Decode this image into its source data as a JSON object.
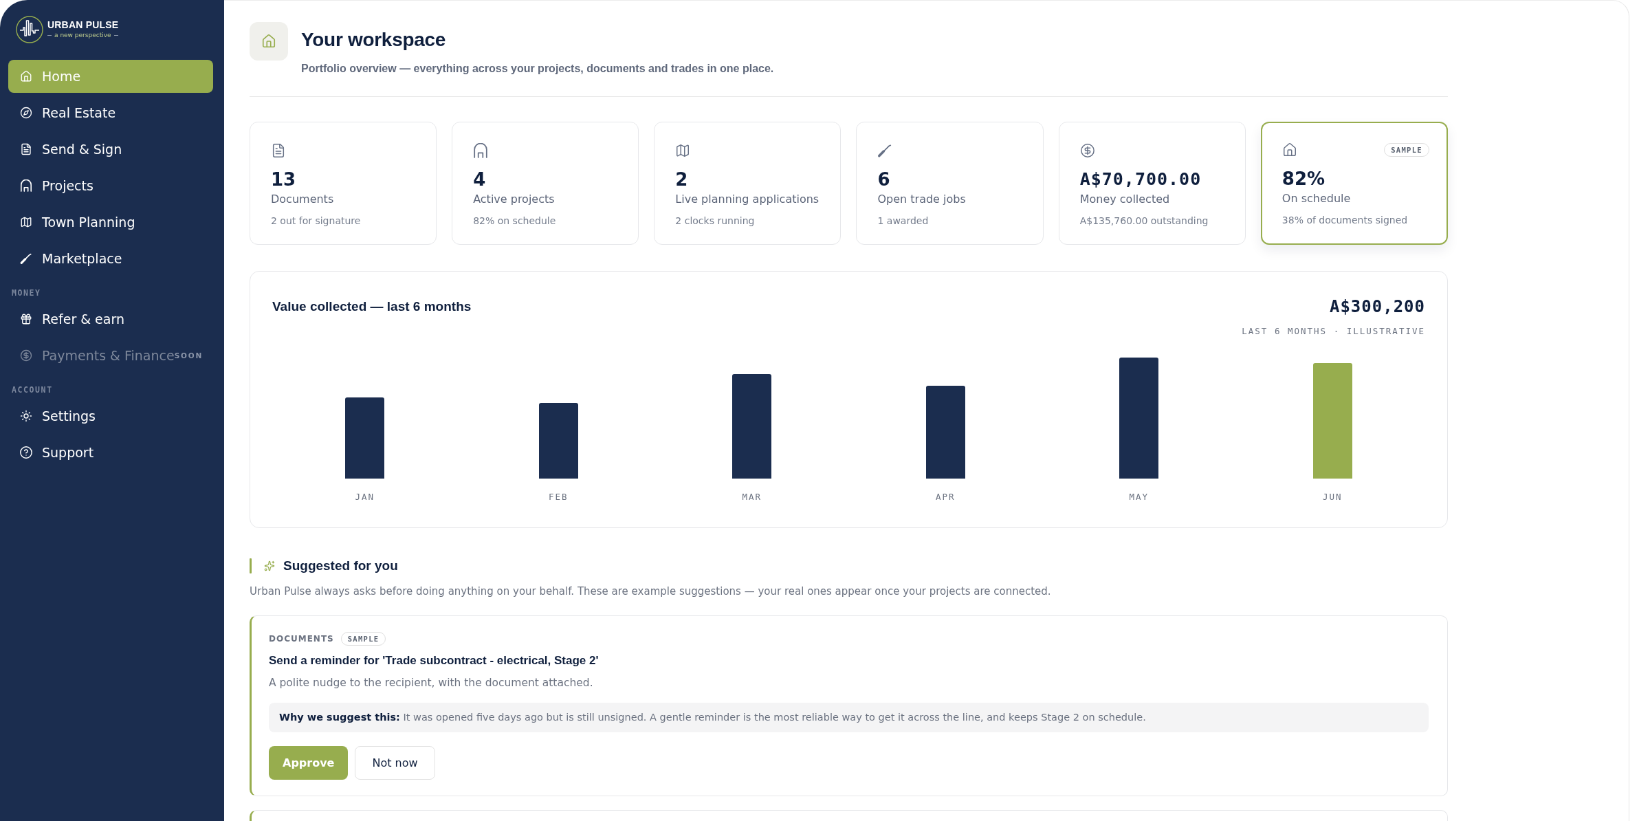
{
  "brand": {
    "name": "URBAN PULSE",
    "tagline": "a new perspective"
  },
  "sidebar": {
    "sections": [
      {
        "items": [
          {
            "label": "Home",
            "selected": true,
            "disabled": false
          },
          {
            "label": "Real Estate",
            "selected": false,
            "disabled": false
          },
          {
            "label": "Send & Sign",
            "selected": false,
            "disabled": false
          },
          {
            "label": "Projects",
            "selected": false,
            "disabled": false
          },
          {
            "label": "Town Planning",
            "selected": false,
            "disabled": false
          },
          {
            "label": "Marketplace",
            "selected": false,
            "disabled": false
          }
        ]
      },
      {
        "title": "MONEY",
        "items": [
          {
            "label": "Refer & earn",
            "selected": false,
            "disabled": false
          },
          {
            "label": "Payments & Finance",
            "selected": false,
            "disabled": true,
            "badge": "SOON"
          }
        ]
      },
      {
        "title": "ACCOUNT",
        "items": [
          {
            "label": "Settings",
            "selected": false,
            "disabled": false
          },
          {
            "label": "Support",
            "selected": false,
            "disabled": false
          }
        ]
      }
    ]
  },
  "header": {
    "title": "Your workspace",
    "subtitle": "Portfolio overview — everything across your projects, documents and trades in one place."
  },
  "stats": [
    {
      "kind": "count",
      "value": "13",
      "label": "Documents",
      "note": "2 out for signature",
      "highlighted": false
    },
    {
      "kind": "count",
      "value": "4",
      "label": "Active projects",
      "note": "82% on schedule",
      "highlighted": false
    },
    {
      "kind": "count",
      "value": "2",
      "label": "Live planning applications",
      "note": "2 clocks running",
      "highlighted": false
    },
    {
      "kind": "count",
      "value": "6",
      "label": "Open trade jobs",
      "note": "1 awarded",
      "highlighted": false
    },
    {
      "kind": "money",
      "value": "A$70,700.00",
      "label": "Money collected",
      "note": "A$135,760.00 outstanding",
      "highlighted": false
    },
    {
      "kind": "count",
      "value": "82%",
      "label": "On schedule",
      "note": "38% of documents signed",
      "highlighted": true,
      "badge": "SAMPLE"
    }
  ],
  "chart": {
    "title": "Value collected — last 6 months",
    "total": "A$300,200",
    "caption": "LAST 6 MONTHS · ILLUSTRATIVE",
    "months": [
      {
        "label": "JAN",
        "highlighted": false
      },
      {
        "label": "FEB",
        "highlighted": false
      },
      {
        "label": "MAR",
        "highlighted": false
      },
      {
        "label": "APR",
        "highlighted": false
      },
      {
        "label": "MAY",
        "highlighted": false
      },
      {
        "label": "JUN",
        "highlighted": true
      }
    ]
  },
  "suggestions": {
    "title": "Suggested for you",
    "intro": "Urban Pulse always asks before doing anything on your behalf. These are example suggestions — your real ones appear once your projects are connected.",
    "cards": [
      {
        "category": "DOCUMENTS",
        "badge": "SAMPLE",
        "title": "Send a reminder for 'Trade subcontract - electrical, Stage 2'",
        "description": "A polite nudge to the recipient, with the document attached.",
        "reason": "**Why we suggest this:** It was opened five days ago but is still unsigned. A gentle reminder is the most reliable way to get it across the line, and keeps Stage 2 on schedule.",
        "actions": [
          {
            "label": "Approve",
            "kind": "primary"
          },
          {
            "label": "Not now",
            "kind": "secondary"
          }
        ]
      }
    ]
  }
}
